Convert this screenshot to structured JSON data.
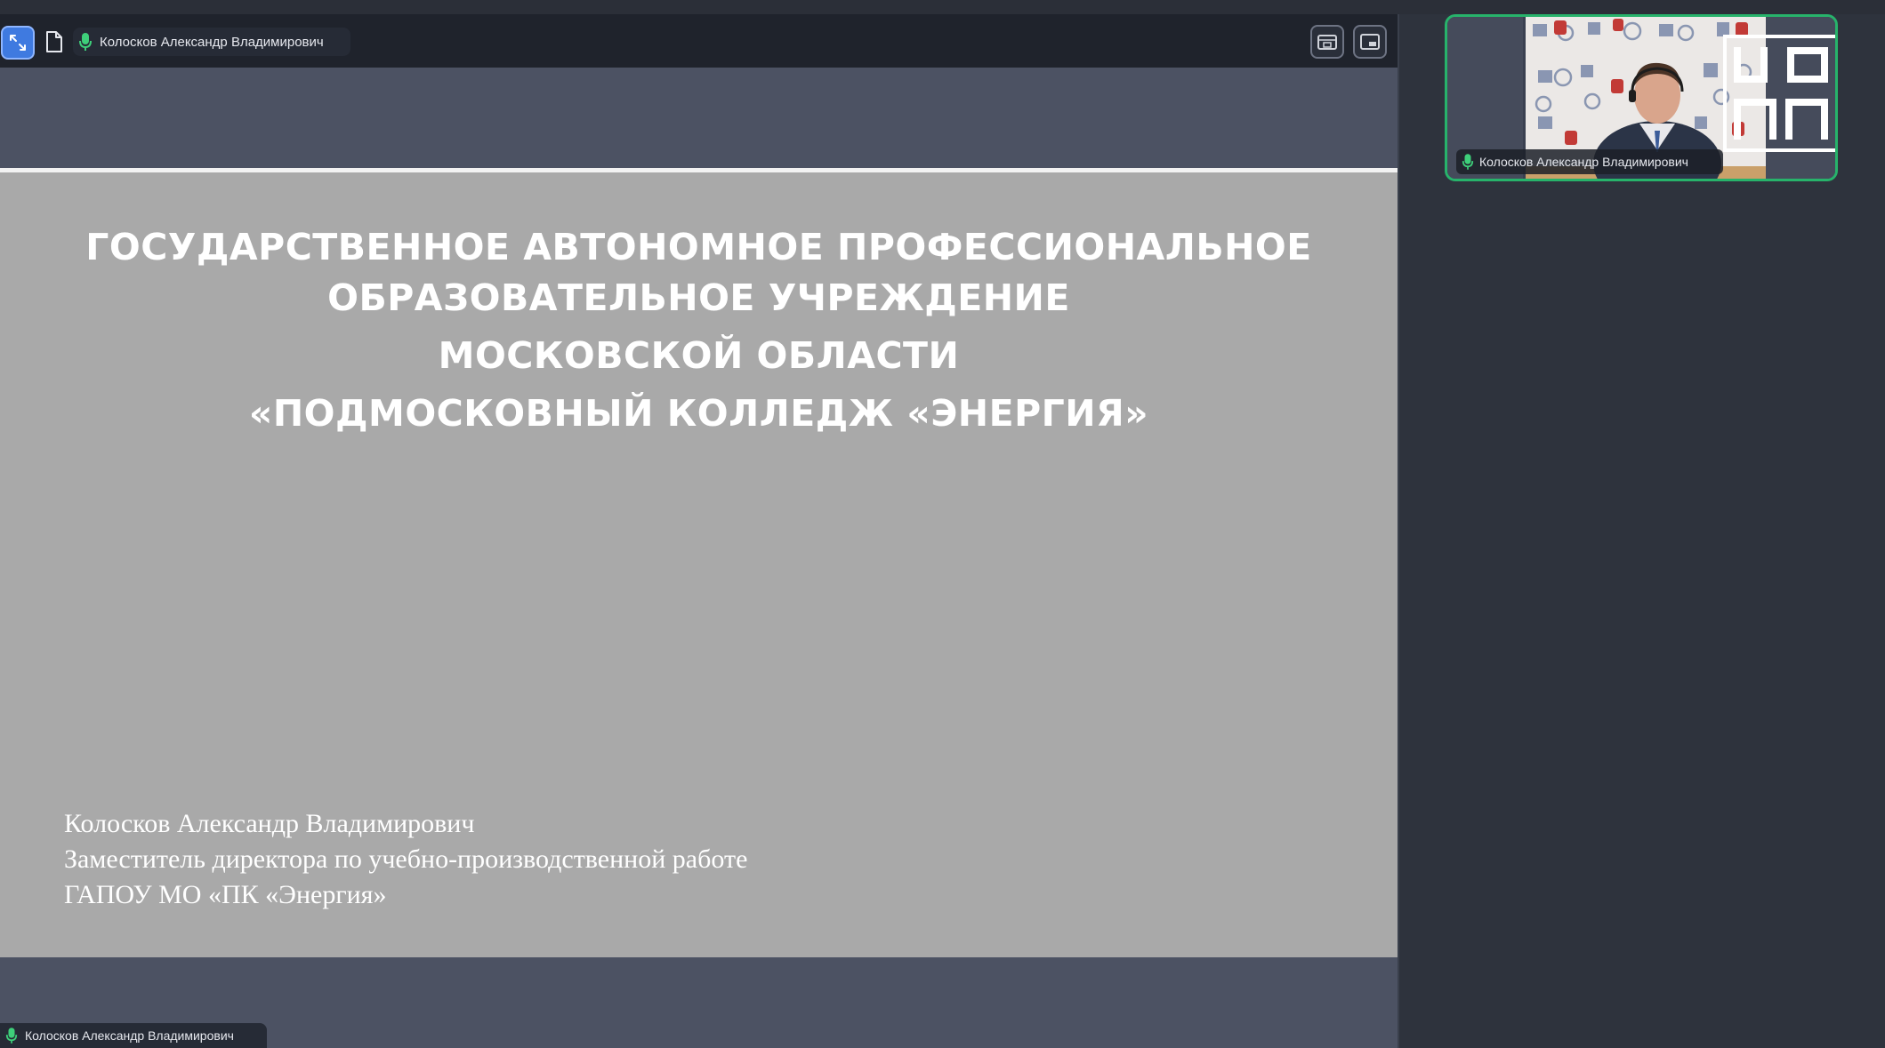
{
  "toolbar": {
    "speaker_name": "Колосков Александр Владимирович"
  },
  "slide": {
    "title_lines": [
      "ГОСУДАРСТВЕННОЕ АВТОНОМНОЕ ПРОФЕССИОНАЛЬНОЕ",
      "ОБРАЗОВАТЕЛЬНОЕ УЧРЕЖДЕНИЕ",
      "МОСКОВСКОЙ ОБЛАСТИ",
      "«ПОДМОСКОВНЫЙ КОЛЛЕДЖ «ЭНЕРГИЯ»"
    ],
    "author_lines": [
      "Колосков Александр Владимирович",
      "Заместитель директора по учебно-производственной работе",
      "ГАПОУ МО «ПК «Энергия»"
    ]
  },
  "bottom_bar": {
    "speaker_name": "Колосков Александр Владимирович"
  },
  "participant": {
    "name": "Колосков Александр Владимирович"
  },
  "colors": {
    "accent_blue": "#3f7ae0",
    "active_speaker_border": "#27b36b",
    "mic_green": "#3ecf7a",
    "slide_background": "#a9a9a9"
  },
  "icons": {
    "expand": "expand-arrows-icon",
    "document": "document-icon",
    "microphone": "microphone-icon",
    "picture_in_picture": "pip-icon",
    "fullscreen": "fullscreen-icon"
  }
}
